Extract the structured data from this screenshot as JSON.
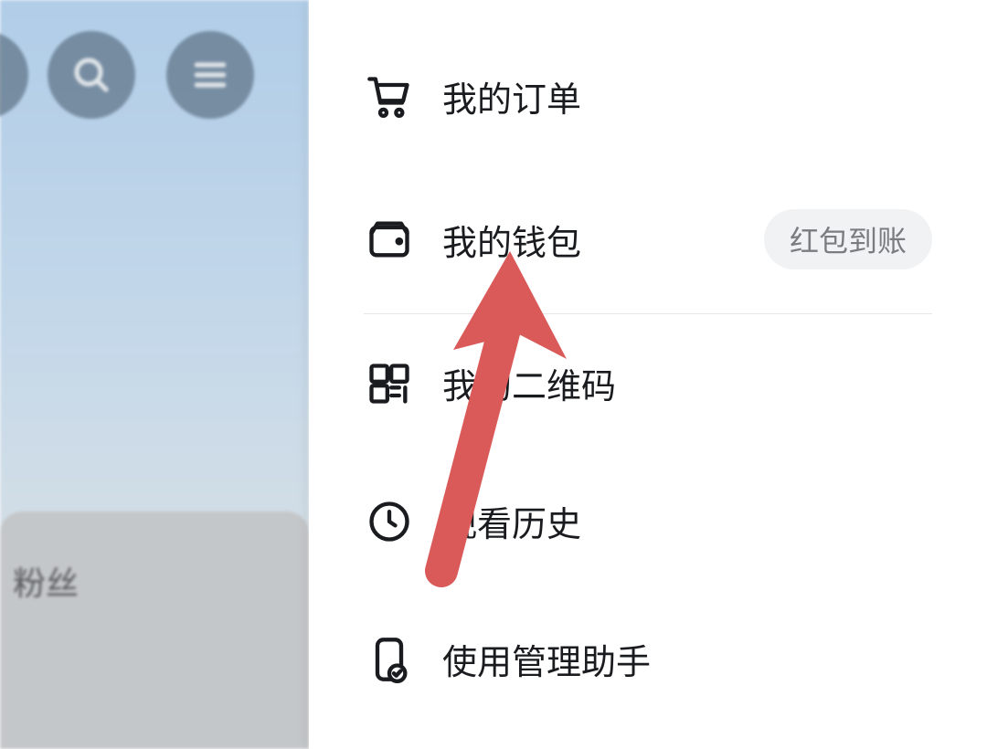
{
  "background": {
    "followers_label": "粉丝"
  },
  "menu": {
    "orders": {
      "label": "我的订单"
    },
    "wallet": {
      "label": "我的钱包",
      "badge": "红包到账"
    },
    "qrcode": {
      "label": "我的二维码"
    },
    "history": {
      "label": "观看历史"
    },
    "assistant": {
      "label": "使用管理助手"
    }
  },
  "colors": {
    "arrow": "#da5a5a",
    "icon": "#1a1b1f"
  }
}
